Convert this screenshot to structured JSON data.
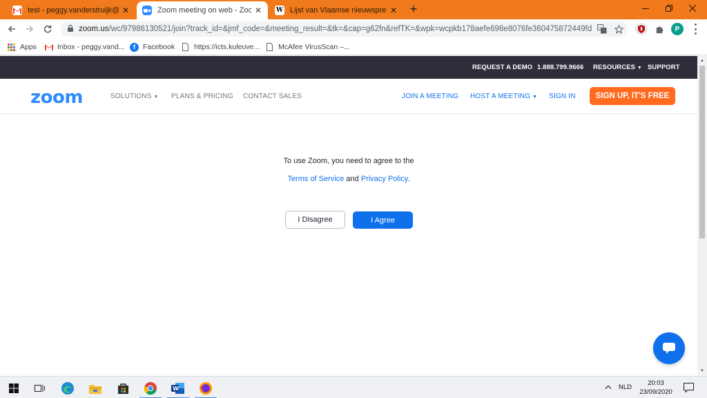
{
  "browser": {
    "tabs": [
      {
        "title": "test - peggy.vanderstruijk@gmai",
        "icon": "gmail-icon",
        "active": false
      },
      {
        "title": "Zoom meeting on web - Zoom",
        "icon": "zoom-icon",
        "active": true
      },
      {
        "title": "Lijst van Vlaamse nieuwspresent",
        "icon": "wikipedia-icon",
        "active": false
      }
    ],
    "tab_close": "✕",
    "new_tab": "+",
    "url_host": "zoom.us",
    "url_path": "/wc/97986130521/join?track_id=&jmf_code=&meeting_result=&tk=&cap=g62fn&refTK=&wpk=wcpkb178aefe698e8076fe360475872449fd",
    "profile_initial": "P",
    "bookmarks": [
      {
        "label": "Apps",
        "icon": "apps-grid-icon"
      },
      {
        "label": "Inbox - peggy.vand...",
        "icon": "gmail-icon"
      },
      {
        "label": "Facebook",
        "icon": "facebook-icon"
      },
      {
        "label": "https://icts.kuleuve...",
        "icon": "page-icon"
      },
      {
        "label": "McAfee VirusScan –...",
        "icon": "page-icon"
      }
    ]
  },
  "zoom": {
    "top_links": [
      "REQUEST A DEMO",
      "1.888.799.9666",
      "RESOURCES",
      "SUPPORT"
    ],
    "logo": "zoom",
    "nav_left": [
      "SOLUTIONS",
      "PLANS & PRICING",
      "CONTACT SALES"
    ],
    "nav_right": [
      "JOIN A MEETING",
      "HOST A MEETING",
      "SIGN IN"
    ],
    "signup": "SIGN UP, IT'S FREE",
    "message_line1": "To use Zoom, you need to agree to the",
    "terms_link": "Terms of Service",
    "and_text": "and",
    "privacy_link": "Privacy Policy",
    "period": ".",
    "disagree": "I Disagree",
    "agree": "I Agree",
    "accent_color": "#0e71eb",
    "signup_color": "#ff6a1f"
  },
  "taskbar": {
    "language": "NLD",
    "time": "20:03",
    "date": "23/09/2020",
    "apps": [
      "start-icon",
      "task-view-icon",
      "edge-icon",
      "file-explorer-icon",
      "store-icon",
      "chrome-icon",
      "word-icon",
      "firefox-icon"
    ]
  }
}
